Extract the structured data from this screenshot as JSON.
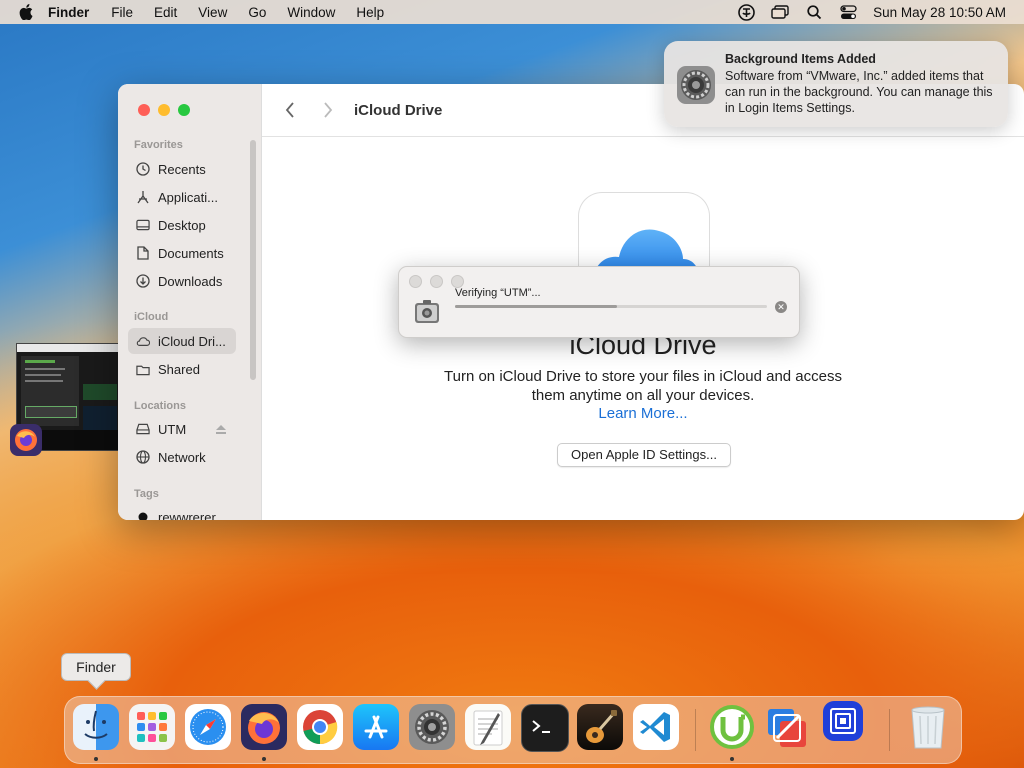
{
  "menubar": {
    "app_name": "Finder",
    "items": [
      "File",
      "Edit",
      "View",
      "Go",
      "Window",
      "Help"
    ],
    "clock": "Sun May 28  10:50 AM",
    "status_icons": [
      "vpn-icon",
      "screen-mirroring-icon",
      "spotlight-icon",
      "control-center-icon"
    ]
  },
  "finder": {
    "toolbar_title": "iCloud Drive",
    "sidebar": {
      "favorites_header": "Favorites",
      "favorites": [
        "Recents",
        "Applicati...",
        "Desktop",
        "Documents",
        "Downloads"
      ],
      "icloud_header": "iCloud",
      "icloud_items": [
        "iCloud Dri...",
        "Shared"
      ],
      "locations_header": "Locations",
      "locations": [
        "UTM",
        "Network"
      ],
      "tags_header": "Tags",
      "tags": [
        "rewwrerer"
      ]
    },
    "content": {
      "title": "iCloud Drive",
      "description_line1": "Turn on iCloud Drive to store your files in iCloud and access",
      "description_line2": "them anytime on all your devices.",
      "learn_more": "Learn More...",
      "button": "Open Apple ID Settings..."
    }
  },
  "verify_dialog": {
    "text": "Verifying “UTM”...",
    "progress": 0.52
  },
  "notification": {
    "title": "Background Items Added",
    "body": "Software from “VMware, Inc.” added items that can run in the background. You can manage this in Login Items Settings."
  },
  "dock": {
    "tooltip": "Finder",
    "apps": [
      "finder",
      "launchpad",
      "safari",
      "firefox",
      "chrome",
      "app-store",
      "system-settings",
      "textedit",
      "terminal",
      "garageband",
      "vscode",
      "utorrent",
      "vmware-fusion",
      "utm",
      "trash"
    ]
  },
  "colors": {
    "accent": "#1a6fd6",
    "close": "#fe5f57",
    "minimize": "#febc2e",
    "zoom": "#28c840"
  }
}
